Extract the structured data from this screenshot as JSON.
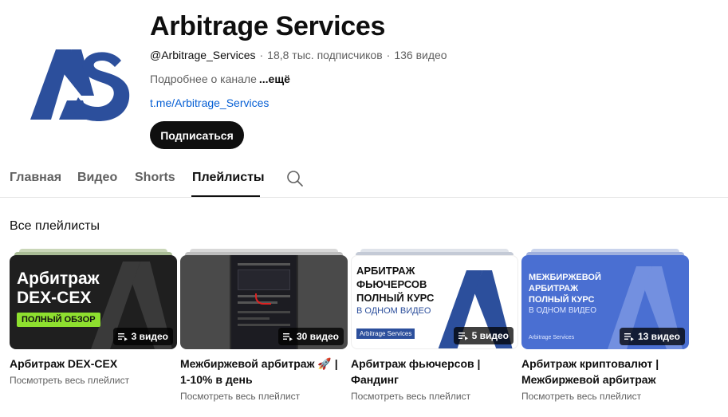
{
  "channel": {
    "title": "Arbitrage Services",
    "handle": "@Arbitrage_Services",
    "subscribers": "18,8 тыс. подписчиков",
    "video_count": "136 видео",
    "about": "Подробнее о канале",
    "about_more": "...ещё",
    "link": "t.me/Arbitrage_Services",
    "subscribe_label": "Подписаться",
    "brand_color": "#2c4f9c"
  },
  "tabs": [
    {
      "label": "Главная",
      "active": false
    },
    {
      "label": "Видео",
      "active": false
    },
    {
      "label": "Shorts",
      "active": false
    },
    {
      "label": "Плейлисты",
      "active": true
    }
  ],
  "section_title": "Все плейлисты",
  "playlists": [
    {
      "thumb_lines": [
        "Арбитраж",
        "DEX-CEX"
      ],
      "thumb_tag": "ПОЛНЫЙ ОБЗОР",
      "badge": "3 видео",
      "title": "Арбитраж DEX-CEX",
      "link": "Посмотреть весь плейлист"
    },
    {
      "badge": "30 видео",
      "title": "Межбиржевой арбитраж 🚀 | 1-10% в день",
      "link": "Посмотреть весь плейлист"
    },
    {
      "thumb_lines": [
        "АРБИТРАЖ",
        "ФЬЮЧЕРСОВ",
        "ПОЛНЫЙ КУРС"
      ],
      "thumb_sub": "В ОДНОМ ВИДЕО",
      "thumb_footer": "Arbitrage Services",
      "badge": "5 видео",
      "title": "Арбитраж фьючерсов | Фандинг",
      "link": "Посмотреть весь плейлист"
    },
    {
      "thumb_lines": [
        "МЕЖБИРЖЕВОЙ",
        "АРБИТРАЖ",
        "ПОЛНЫЙ КУРС"
      ],
      "thumb_sub": "В ОДНОМ ВИДЕО",
      "thumb_footer": "Arbitrage Services",
      "badge": "13 видео",
      "title": "Арбитраж криптовалют | Межбиржевой арбитраж",
      "link": "Посмотреть весь плейлист"
    }
  ]
}
